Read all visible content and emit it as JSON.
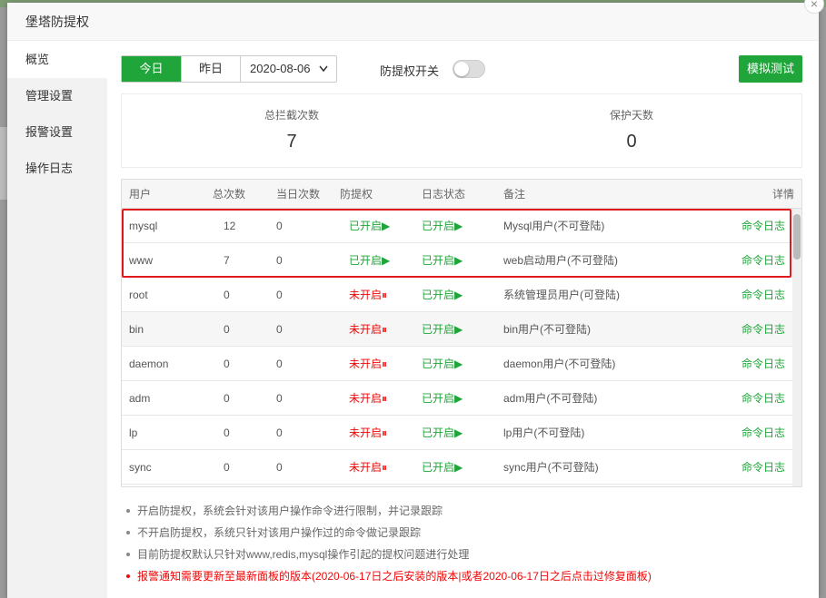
{
  "dialog": {
    "title": "堡塔防提权",
    "close": "×"
  },
  "nav": {
    "items": [
      "概览",
      "管理设置",
      "报警设置",
      "操作日志"
    ]
  },
  "toolbar": {
    "today": "今日",
    "yesterday": "昨日",
    "date": "2020-08-06",
    "switch_label": "防提权开关",
    "simulate": "模拟测试"
  },
  "stats": {
    "blocked_label": "总拦截次数",
    "blocked_value": "7",
    "days_label": "保护天数",
    "days_value": "0"
  },
  "table": {
    "headers": [
      "用户",
      "总次数",
      "当日次数",
      "防提权",
      "日志状态",
      "备注",
      "详情"
    ],
    "rows": [
      {
        "user": "mysql",
        "total": "12",
        "today": "0",
        "protect": "已开启▶",
        "log": "已开启▶",
        "note": "Mysql用户(不可登陆)",
        "detail": "命令日志"
      },
      {
        "user": "www",
        "total": "7",
        "today": "0",
        "protect": "已开启▶",
        "log": "已开启▶",
        "note": "web启动用户(不可登陆)",
        "detail": "命令日志"
      },
      {
        "user": "root",
        "total": "0",
        "today": "0",
        "protect": "未开启⏸",
        "log": "已开启▶",
        "note": "系统管理员用户(可登陆)",
        "detail": "命令日志"
      },
      {
        "user": "bin",
        "total": "0",
        "today": "0",
        "protect": "未开启⏸",
        "log": "已开启▶",
        "note": "bin用户(不可登陆)",
        "detail": "命令日志"
      },
      {
        "user": "daemon",
        "total": "0",
        "today": "0",
        "protect": "未开启⏸",
        "log": "已开启▶",
        "note": "daemon用户(不可登陆)",
        "detail": "命令日志"
      },
      {
        "user": "adm",
        "total": "0",
        "today": "0",
        "protect": "未开启⏸",
        "log": "已开启▶",
        "note": "adm用户(不可登陆)",
        "detail": "命令日志"
      },
      {
        "user": "lp",
        "total": "0",
        "today": "0",
        "protect": "未开启⏸",
        "log": "已开启▶",
        "note": "lp用户(不可登陆)",
        "detail": "命令日志"
      },
      {
        "user": "sync",
        "total": "0",
        "today": "0",
        "protect": "未开启⏸",
        "log": "已开启▶",
        "note": "sync用户(不可登陆)",
        "detail": "命令日志"
      }
    ]
  },
  "notes": [
    "开启防提权，系统会针对该用户操作命令进行限制，并记录跟踪",
    "不开启防提权，系统只针对该用户操作过的命令做记录跟踪",
    "目前防提权默认只针对www,redis,mysql操作引起的提权问题进行处理",
    "报警通知需要更新至最新面板的版本(2020-06-17日之后安装的版本|或者2020-06-17日之后点击过修复面板)"
  ],
  "colors": {
    "accent": "#20a53a",
    "danger": "#ef0808",
    "highlight": "#e0191d"
  }
}
